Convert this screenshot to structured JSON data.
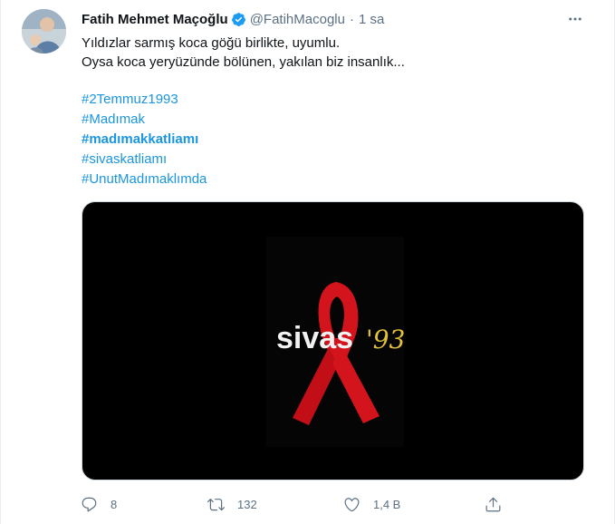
{
  "tweet": {
    "author_name": "Fatih Mehmet Maçoğlu",
    "handle": "@FatihMacoglu",
    "separator": "·",
    "time": "1 sa",
    "text_lines": [
      "Yıldızlar sarmış koca göğü birlikte, uyumlu.",
      "Oysa koca yeryüzünde bölünen, yakılan biz insanlık..."
    ],
    "hashtags": [
      {
        "text": "#2Temmuz1993",
        "bold": false
      },
      {
        "text": "#Madımak",
        "bold": false
      },
      {
        "text": "#madımakkatliamı",
        "bold": true
      },
      {
        "text": "#sivaskatliamı",
        "bold": false
      },
      {
        "text": "#UnutMadımaklımda",
        "bold": false
      }
    ],
    "media": {
      "logo_text_main": "sivas",
      "logo_text_year": "'93",
      "ribbon_color": "#d4141c",
      "logo_year_color": "#e3c13a"
    },
    "actions": {
      "reply_count": "8",
      "retweet_count": "132",
      "like_count": "1,4 B"
    }
  },
  "colors": {
    "link": "#1b95e0",
    "secondary": "#5b7083",
    "verified": "#1d9bf0"
  }
}
